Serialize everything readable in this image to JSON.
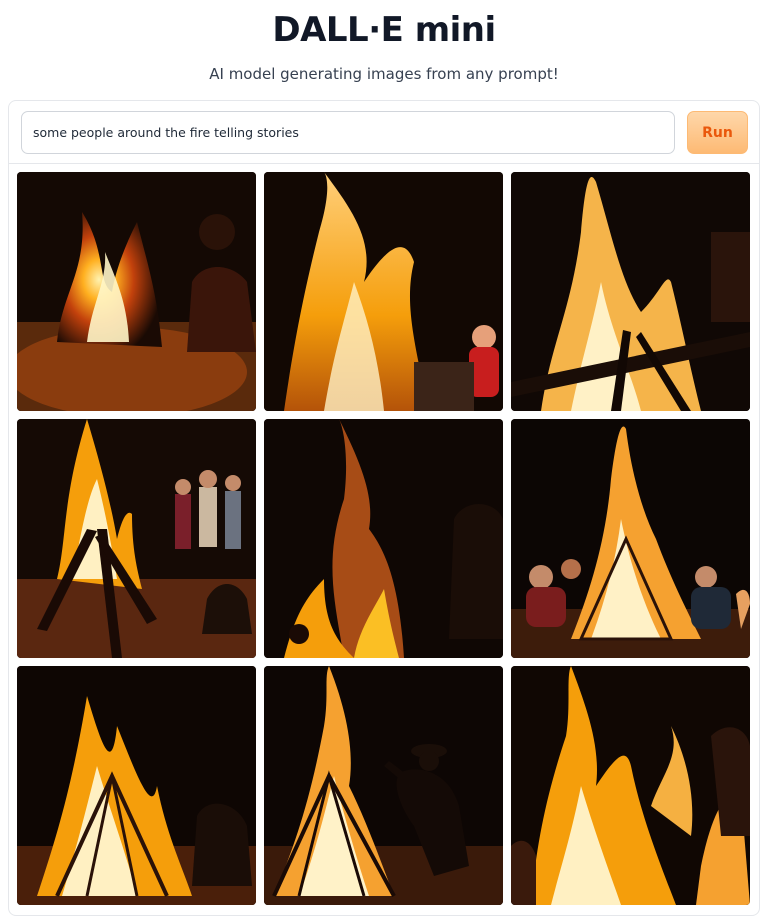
{
  "app": {
    "title": "DALL·E mini",
    "subtitle": "AI model generating images from any prompt!"
  },
  "prompt": {
    "value": "some people around the fire telling stories"
  },
  "run_label": "Run",
  "gallery": {
    "images": [
      {
        "name": "generated-image-1"
      },
      {
        "name": "generated-image-2"
      },
      {
        "name": "generated-image-3"
      },
      {
        "name": "generated-image-4"
      },
      {
        "name": "generated-image-5"
      },
      {
        "name": "generated-image-6"
      },
      {
        "name": "generated-image-7"
      },
      {
        "name": "generated-image-8"
      },
      {
        "name": "generated-image-9"
      }
    ]
  }
}
